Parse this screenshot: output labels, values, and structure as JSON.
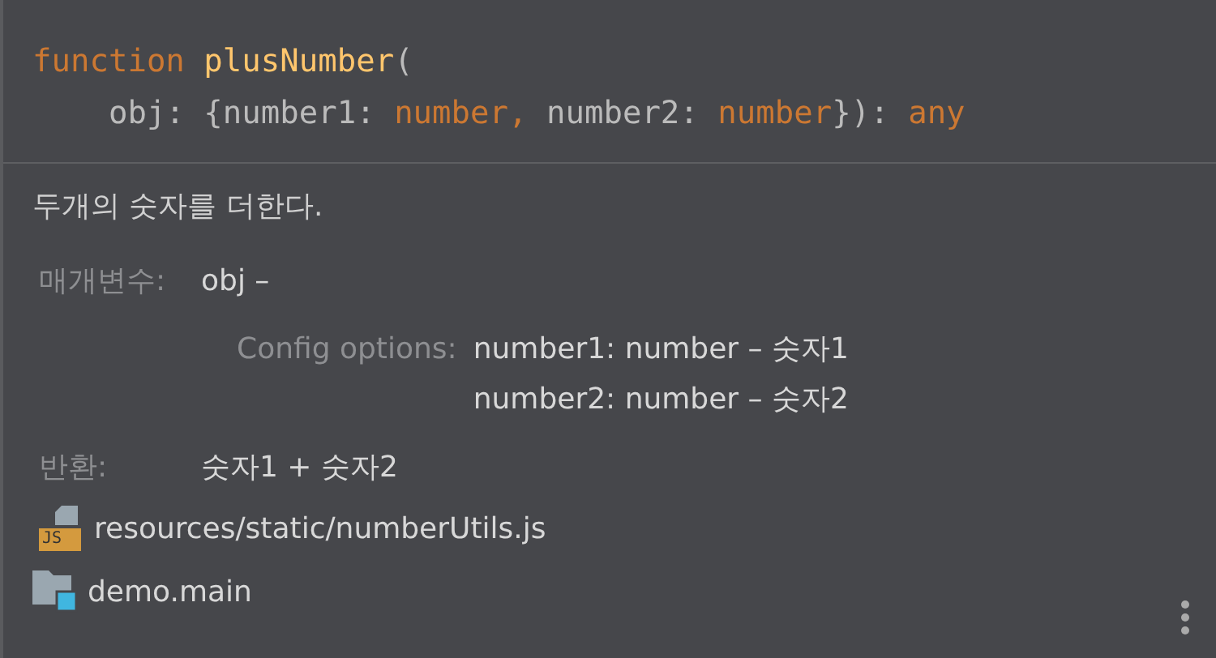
{
  "signature": [
    [
      {
        "text": "function ",
        "kind": "keyword"
      },
      {
        "text": "plusNumber",
        "kind": "name"
      },
      {
        "text": "(",
        "kind": "plain"
      }
    ],
    [
      {
        "text": "    obj: {number1: ",
        "kind": "plain"
      },
      {
        "text": "number,",
        "kind": "type"
      },
      {
        "text": " number2: ",
        "kind": "plain"
      },
      {
        "text": "number",
        "kind": "type"
      },
      {
        "text": "}): ",
        "kind": "plain"
      },
      {
        "text": "any",
        "kind": "keyword"
      }
    ]
  ],
  "description": "두개의 숫자를 더한다.",
  "params": {
    "label": "매개변수:",
    "value": "obj –"
  },
  "config": {
    "label": "Config options:",
    "items": [
      "number1: number – 숫자1",
      "number2: number – 숫자2"
    ]
  },
  "returns": {
    "label": "반환:",
    "value": "숫자1 + 숫자2"
  },
  "file": {
    "icon_label": "JS",
    "path": "resources/static/numberUtils.js"
  },
  "module": {
    "name": "demo.main"
  }
}
